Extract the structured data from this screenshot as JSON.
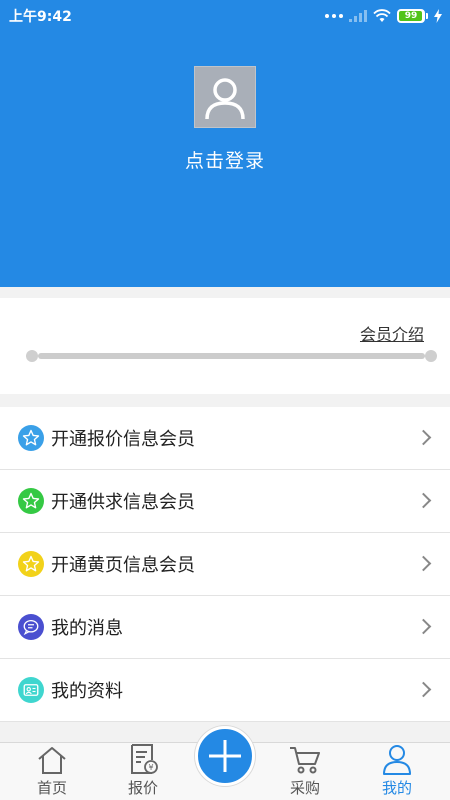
{
  "status_bar": {
    "time": "上午9:42",
    "battery": "99"
  },
  "header": {
    "login_text": "点击登录"
  },
  "member": {
    "intro_link": "会员介绍",
    "progress": 0
  },
  "menu": {
    "items": [
      {
        "label": "开通报价信息会员",
        "icon": "star-icon",
        "color": "#3aa0e8"
      },
      {
        "label": "开通供求信息会员",
        "icon": "star-icon",
        "color": "#35c944"
      },
      {
        "label": "开通黄页信息会员",
        "icon": "star-icon",
        "color": "#f2d21a"
      },
      {
        "label": "我的消息",
        "icon": "message-icon",
        "color": "#4a4fd0"
      },
      {
        "label": "我的资料",
        "icon": "profile-card-icon",
        "color": "#3fd6cf"
      }
    ]
  },
  "tabbar": {
    "home": "首页",
    "quote": "报价",
    "purchase": "采购",
    "mine": "我的",
    "active": "mine",
    "active_color": "#2489e4"
  }
}
